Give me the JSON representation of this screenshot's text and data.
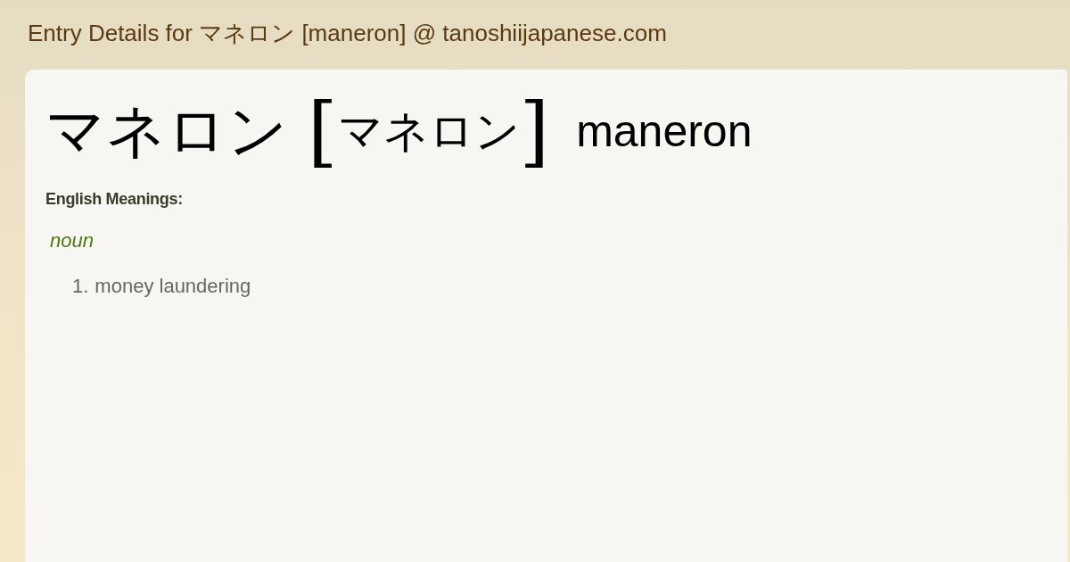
{
  "page_title": "Entry Details for マネロン [maneron] @ tanoshiijapanese.com",
  "entry": {
    "headword": "マネロン",
    "bracket_open": "[",
    "reading": "マネロン",
    "bracket_close": "]",
    "romaji": "maneron"
  },
  "meanings_label": "English Meanings:",
  "senses": [
    {
      "pos": "noun",
      "meanings": [
        {
          "number": "1.",
          "text": "money laundering"
        }
      ]
    }
  ]
}
